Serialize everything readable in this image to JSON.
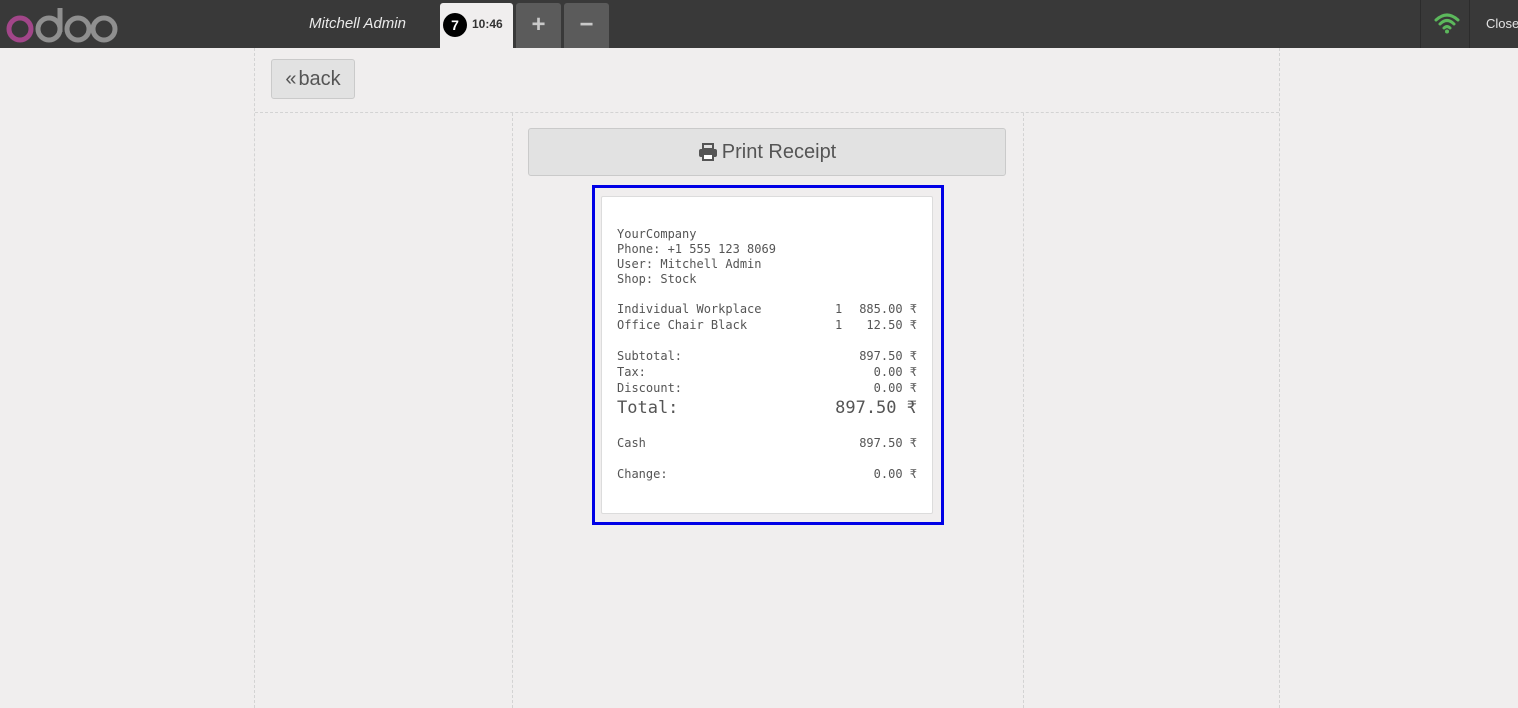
{
  "header": {
    "logo_text": "odoo",
    "cashier_name": "Mitchell Admin",
    "order_tab": {
      "sequence": "7",
      "time": "10:46"
    },
    "add_order_label": "+",
    "remove_order_label": "−",
    "close_label": "Close",
    "wifi_icon": "wifi-icon",
    "wifi_color": "#5cb85c"
  },
  "actions": {
    "back_label": "back",
    "print_label": "Print Receipt"
  },
  "receipt": {
    "company": "YourCompany",
    "phone": "Phone: +1 555 123 8069",
    "user": "User: Mitchell Admin",
    "shop": "Shop: Stock",
    "lines": [
      {
        "product": "Individual Workplace",
        "qty": "1",
        "price": "885.00 ₹"
      },
      {
        "product": "Office Chair Black",
        "qty": "1",
        "price": "12.50 ₹"
      }
    ],
    "subtotal_label": "Subtotal:",
    "subtotal_value": "897.50 ₹",
    "tax_label": "Tax:",
    "tax_value": "0.00 ₹",
    "discount_label": "Discount:",
    "discount_value": "0.00 ₹",
    "total_label": "Total:",
    "total_value": "897.50 ₹",
    "payment_label": "Cash",
    "payment_value": "897.50 ₹",
    "change_label": "Change:",
    "change_value": "0.00 ₹"
  },
  "colors": {
    "topbar": "#393939",
    "highlight_border": "#0000e6",
    "logo_purple": "#a24689",
    "logo_gray": "#8f8f8f"
  }
}
